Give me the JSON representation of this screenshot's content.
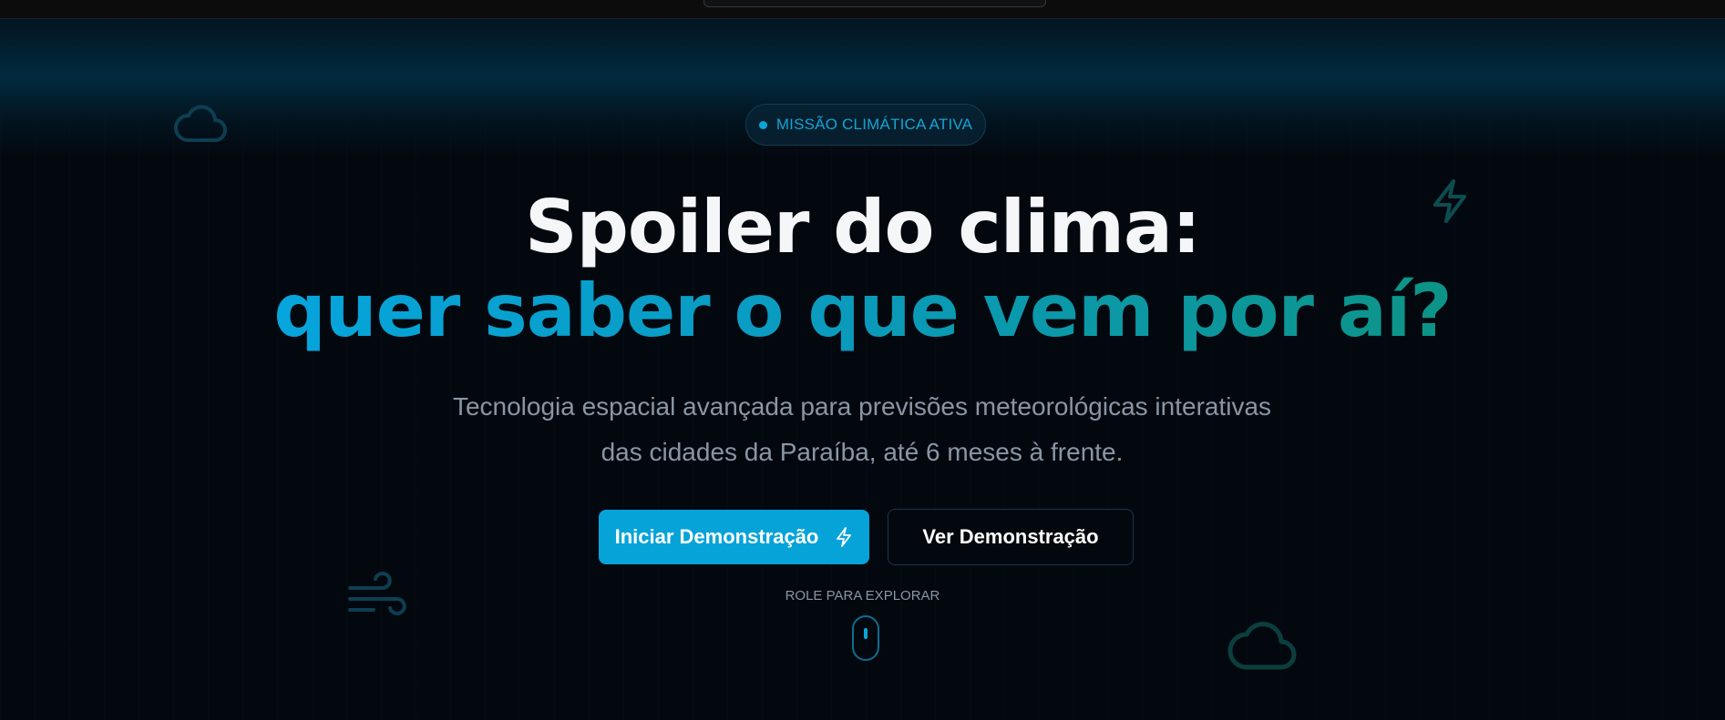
{
  "colors": {
    "background": "#03080f",
    "accent_blue": "#06a3d9",
    "accent_teal": "#0d9487",
    "title_white": "#f4f6f8",
    "muted_text": "#8a96a4"
  },
  "hero": {
    "badge_label": "MISSÃO CLIMÁTICA ATIVA",
    "title_line1": "Spoiler do clima:",
    "title_line2": "quer saber o que vem por aí?",
    "subtitle_line1": "Tecnologia espacial avançada para previsões meteorológicas interativas",
    "subtitle_line2": "das cidades da Paraíba, até 6 meses à frente."
  },
  "actions": {
    "primary_label": "Iniciar Demonstração",
    "primary_icon": "lightning-icon",
    "secondary_label": "Ver Demonstração"
  },
  "scroll": {
    "hint": "ROLE PARA EXPLORAR",
    "icon": "mouse-scroll-icon"
  },
  "decorations": {
    "icons": [
      "cloud-icon",
      "lightning-icon",
      "wind-icon",
      "cloud-icon"
    ]
  }
}
